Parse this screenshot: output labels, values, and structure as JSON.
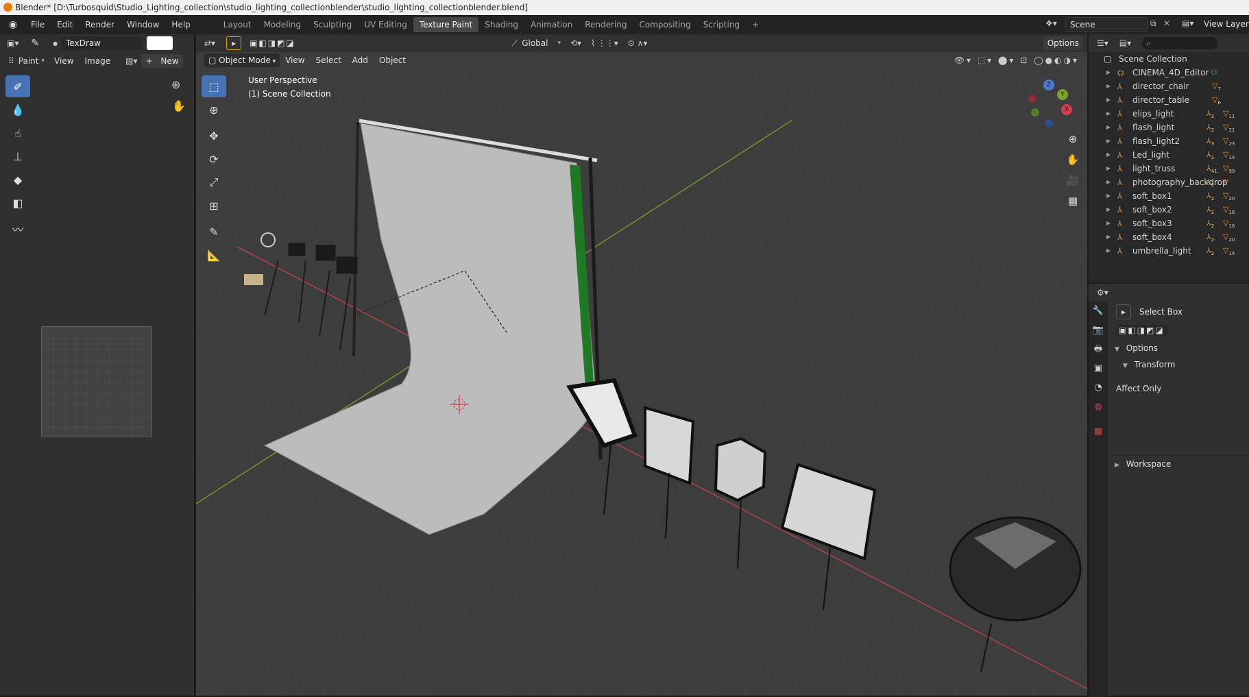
{
  "window": {
    "title": "Blender* [D:\\Turbosquid\\Studio_Lighting_collection\\studio_lighting_collectionblender\\studio_lighting_collectionblender.blend]"
  },
  "menu": [
    "File",
    "Edit",
    "Render",
    "Window",
    "Help"
  ],
  "workspaces": {
    "tabs": [
      "Layout",
      "Modeling",
      "Sculpting",
      "UV Editing",
      "Texture Paint",
      "Shading",
      "Animation",
      "Rendering",
      "Compositing",
      "Scripting"
    ],
    "active": "Texture Paint",
    "add": "+"
  },
  "scene": {
    "name": "Scene",
    "view_layer": "View Layer"
  },
  "image_editor": {
    "brush_name": "TexDraw",
    "mode": "Paint",
    "menus": [
      "View",
      "Image"
    ],
    "new_label": "New",
    "new_plus": "+"
  },
  "viewport": {
    "mode": "Object Mode",
    "menus": [
      "View",
      "Select",
      "Add",
      "Object"
    ],
    "transform_orientation": "Global",
    "options_label": "Options",
    "overlay_line1": "User Perspective",
    "overlay_line2": "(1) Scene Collection",
    "gizmo_axes": {
      "x": "X",
      "y": "Y",
      "z": "Z"
    }
  },
  "outliner": {
    "root": "Scene Collection",
    "items": [
      {
        "name": "CINEMA_4D_Editor",
        "kind": "collection"
      },
      {
        "name": "director_chair",
        "tri_sub": "7"
      },
      {
        "name": "director_table",
        "tri_sub": "6"
      },
      {
        "name": "elips_light",
        "bone_sub": "2",
        "tri_sub": "11"
      },
      {
        "name": "flash_light",
        "bone_sub": "2",
        "tri_sub": "21"
      },
      {
        "name": "flash_light2",
        "bone_sub": "3",
        "tri_sub": "23"
      },
      {
        "name": "Led_light",
        "bone_sub": "2",
        "tri_sub": "14"
      },
      {
        "name": "light_truss",
        "bone_sub": "41",
        "tri_sub": "99"
      },
      {
        "name": "photography_backdrop",
        "bone_sub": "2",
        "tri_sub": ""
      },
      {
        "name": "soft_box1",
        "bone_sub": "2",
        "tri_sub": "20"
      },
      {
        "name": "soft_box2",
        "bone_sub": "2",
        "tri_sub": "16"
      },
      {
        "name": "soft_box3",
        "bone_sub": "2",
        "tri_sub": "16"
      },
      {
        "name": "soft_box4",
        "bone_sub": "2",
        "tri_sub": "20"
      },
      {
        "name": "umbrella_light",
        "bone_sub": "2",
        "tri_sub": "14"
      }
    ]
  },
  "properties": {
    "tool_name": "Select Box",
    "options_label": "Options",
    "transform_label": "Transform",
    "affect_only_label": "Affect Only",
    "workspace_label": "Workspace"
  },
  "colors": {
    "accent": "#4772b3",
    "active_tab": "#474747",
    "x_axis": "#c8404a",
    "y_axis": "#7ca32c"
  }
}
